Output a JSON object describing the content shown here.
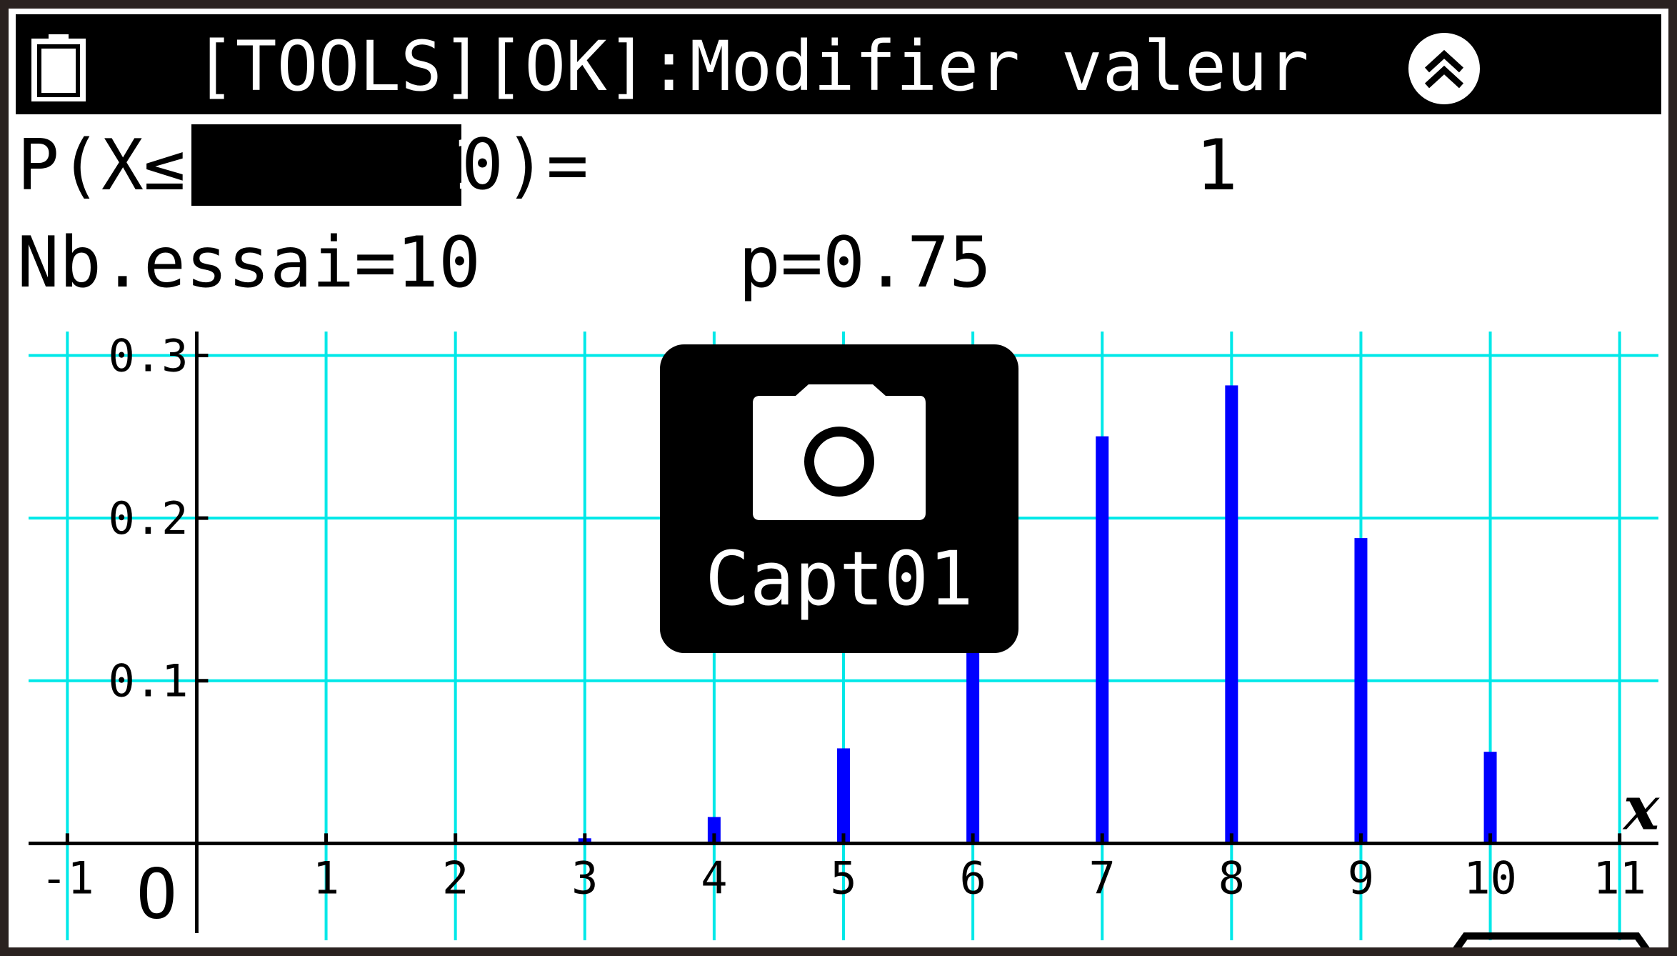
{
  "status_bar": {
    "hint": "[TOOLS][OK]:Modifier valeur",
    "battery_icon": "battery-icon",
    "scroll_icon": "double-chevron-up-icon"
  },
  "probability": {
    "prefix": "P(X≤",
    "value_leading": "1",
    "value_cursor": "0",
    "suffix": ")=",
    "result": "1"
  },
  "parameters": {
    "trials": "Nb.essai=10",
    "p": "p=0.75"
  },
  "capture": {
    "label": "Capt01",
    "icon": "camera-icon"
  },
  "colors": {
    "grid": "#00e8e8",
    "bars": "#0000ff",
    "axis": "#000000",
    "background": "#ffffff"
  },
  "chart_data": {
    "type": "bar",
    "x": [
      0,
      1,
      2,
      3,
      4,
      5,
      6,
      7,
      8,
      9,
      10
    ],
    "values": [
      1e-06,
      3e-05,
      0.0004,
      0.0031,
      0.0162,
      0.0584,
      0.146,
      0.2503,
      0.2816,
      0.1877,
      0.0563
    ],
    "x_ticks": [
      -1,
      1,
      2,
      3,
      4,
      5,
      6,
      7,
      8,
      9,
      10,
      11
    ],
    "y_ticks": [
      "0.1",
      "0.2",
      "0.3"
    ],
    "origin_label": "O",
    "xlabel": "x",
    "xlim": [
      -1.3,
      11.3
    ],
    "ylim": [
      -0.064,
      0.32
    ],
    "grid": true
  }
}
